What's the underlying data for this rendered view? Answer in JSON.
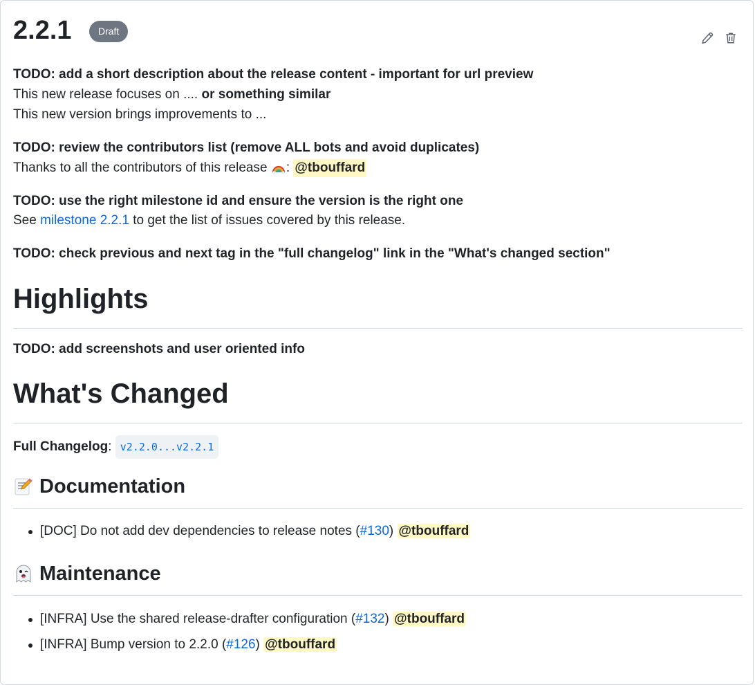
{
  "release": {
    "title": "2.2.1",
    "badge": "Draft",
    "edit_icon": "pencil-icon",
    "delete_icon": "trash-icon"
  },
  "intro": {
    "todo1": "TODO: add a short description about the release content - important for url preview",
    "line1_a": "This new release focuses on .... ",
    "line1_b": "or something similar",
    "line2": "This new version brings improvements to ...",
    "todo2": "TODO: review the contributors list (remove ALL bots and avoid duplicates)",
    "thanks": "Thanks to all the contributors of this release ",
    "rainbow_icon": "rainbow-icon",
    "thanks_colon": ": ",
    "contributor": "@tbouffard",
    "todo3": "TODO: use the right milestone id and ensure the version is the right one",
    "see": "See ",
    "milestone_link": "milestone 2.2.1",
    "milestone_rest": " to get the list of issues covered by this release.",
    "todo4": "TODO: check previous and next tag in the \"full changelog\" link in the \"What's changed section\""
  },
  "highlights": {
    "heading": "Highlights",
    "todo": "TODO: add screenshots and user oriented info"
  },
  "changes": {
    "heading": "What's Changed",
    "full_changelog_label": "Full Changelog",
    "colon": ": ",
    "compare": "v2.2.0...v2.2.1"
  },
  "documentation": {
    "icon": "memo-icon",
    "heading": "Documentation",
    "items": [
      {
        "text": "[DOC] Do not add dev dependencies to release notes (",
        "pr": "#130",
        "close": ") ",
        "author": "@tbouffard"
      }
    ]
  },
  "maintenance": {
    "icon": "ghost-icon",
    "heading": "Maintenance",
    "items": [
      {
        "text": "[INFRA] Use the shared release-drafter configuration (",
        "pr": "#132",
        "close": ") ",
        "author": "@tbouffard"
      },
      {
        "text": "[INFRA] Bump version to 2.2.0 (",
        "pr": "#126",
        "close": ") ",
        "author": "@tbouffard"
      }
    ]
  },
  "colors": {
    "link": "#0969da",
    "text": "#1f2328",
    "badge_bg": "#6e7781",
    "mention_bg": "#fff8c5",
    "border": "#d1d9e0"
  }
}
